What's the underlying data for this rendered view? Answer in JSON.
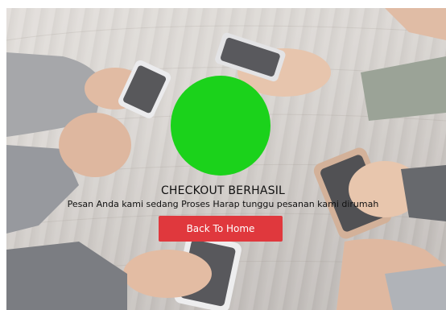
{
  "checkout": {
    "title": "CHECKOUT BERHASIL",
    "message": "Pesan Anda kami sedang Proses Harap tunggu pesanan kami dirumah",
    "button_label": "Back To Home",
    "status_color": "#1bd21b",
    "button_color": "#e0383d"
  },
  "background": {
    "image_description": "people-holding-smartphones-on-wooden-table"
  }
}
